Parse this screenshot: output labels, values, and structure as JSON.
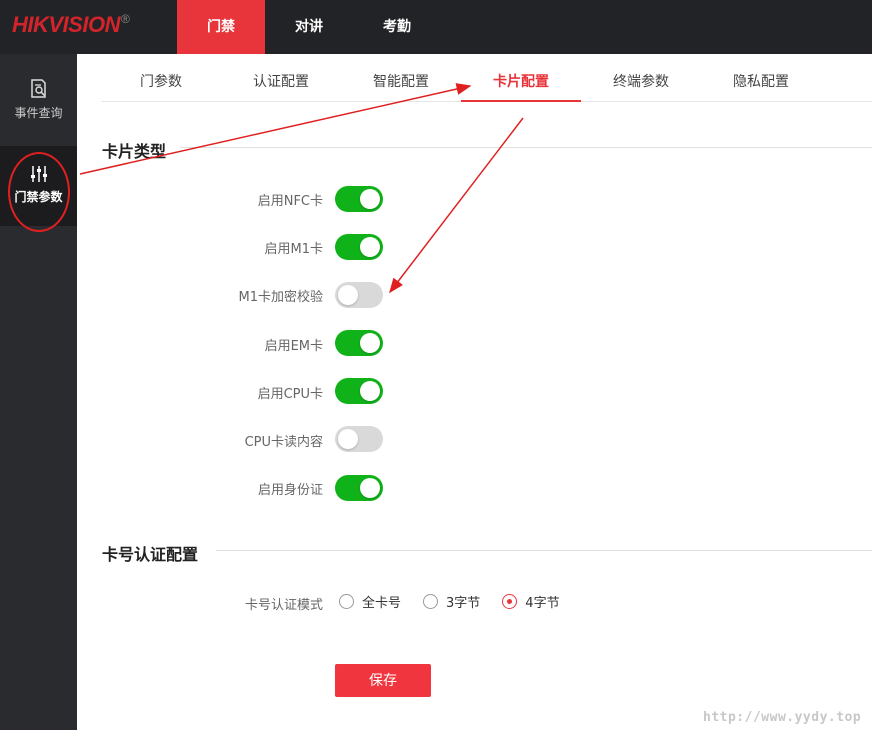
{
  "brand": {
    "logo": "HIKVISION",
    "registered": "®"
  },
  "topnav": [
    {
      "label": "门禁",
      "active": true
    },
    {
      "label": "对讲",
      "active": false
    },
    {
      "label": "考勤",
      "active": false
    }
  ],
  "sidebar": {
    "items": [
      {
        "label": "事件查询",
        "icon": "search-document-icon"
      },
      {
        "label": "门禁参数",
        "icon": "sliders-icon",
        "active": true
      }
    ]
  },
  "subtabs": [
    {
      "label": "门参数"
    },
    {
      "label": "认证配置"
    },
    {
      "label": "智能配置"
    },
    {
      "label": "卡片配置",
      "active": true
    },
    {
      "label": "终端参数"
    },
    {
      "label": "隐私配置"
    }
  ],
  "card_type": {
    "title": "卡片类型",
    "rows": [
      {
        "label": "启用NFC卡",
        "on": true
      },
      {
        "label": "启用M1卡",
        "on": true
      },
      {
        "label": "M1卡加密校验",
        "on": false
      },
      {
        "label": "启用EM卡",
        "on": true
      },
      {
        "label": "启用CPU卡",
        "on": true
      },
      {
        "label": "CPU卡读内容",
        "on": false
      },
      {
        "label": "启用身份证",
        "on": true
      }
    ]
  },
  "card_auth": {
    "title": "卡号认证配置",
    "mode_label": "卡号认证模式",
    "options": [
      {
        "label": "全卡号",
        "checked": false
      },
      {
        "label": "3字节",
        "checked": false
      },
      {
        "label": "4字节",
        "checked": true
      }
    ]
  },
  "save_label": "保存",
  "watermark": "http://www.yydy.top",
  "colors": {
    "accent": "#e8353c",
    "toggle_on": "#10b21a",
    "toggle_off": "#d9d9d9",
    "annotation": "#e02020"
  }
}
